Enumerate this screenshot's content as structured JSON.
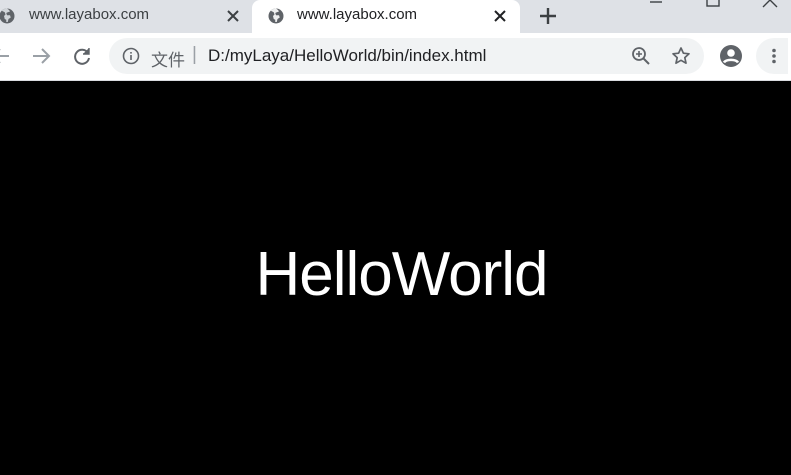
{
  "tabs": [
    {
      "title": "www.layabox.com",
      "favicon": "globe-icon",
      "active": false
    },
    {
      "title": "www.layabox.com",
      "favicon": "globe-icon",
      "active": true
    }
  ],
  "toolbar": {
    "address": {
      "scheme_label": "文件",
      "separator": "|",
      "url": "D:/myLaya/HelloWorld/bin/index.html"
    }
  },
  "page": {
    "text": "HelloWorld"
  },
  "colors": {
    "tabstrip": "#dee1e6",
    "omnibox": "#f1f3f4",
    "page_background": "#000000",
    "page_text": "#ffffff"
  }
}
